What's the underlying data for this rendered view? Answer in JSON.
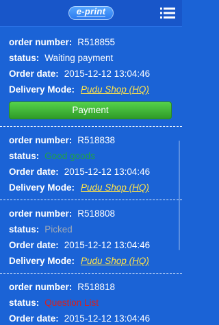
{
  "header": {
    "logo_text": "e-print",
    "logo_icon": "e-print-logo",
    "menu_icon": "hamburger-menu-icon"
  },
  "labels": {
    "order_number": "order number:",
    "status": "status:",
    "order_date": "Order date:",
    "delivery_mode": "Delivery Mode:"
  },
  "orders": [
    {
      "number": "R518855",
      "status": "Waiting payment",
      "date": "2015-12-12 13:04:46",
      "delivery": "Pudu Shop (HQ)",
      "action_label": "Payment"
    },
    {
      "number": "R518838",
      "status": "Good goods",
      "date": "2015-12-12 13:04:46",
      "delivery": "Pudu Shop (HQ)"
    },
    {
      "number": "R518808",
      "status": "Picked",
      "date": "2015-12-12 13:04:46",
      "delivery": "Pudu Shop (HQ)"
    },
    {
      "number": "R518818",
      "status": "Question List",
      "date": "2015-12-12 13:04:46"
    }
  ],
  "colors": {
    "background": "#1b63d6",
    "header": "#1856c9",
    "delivery_link": "#ffe34a",
    "payment_button": "#3fae34",
    "status_good": "#20a04a",
    "status_picked": "#9ea8b6",
    "status_question": "#d82020"
  }
}
